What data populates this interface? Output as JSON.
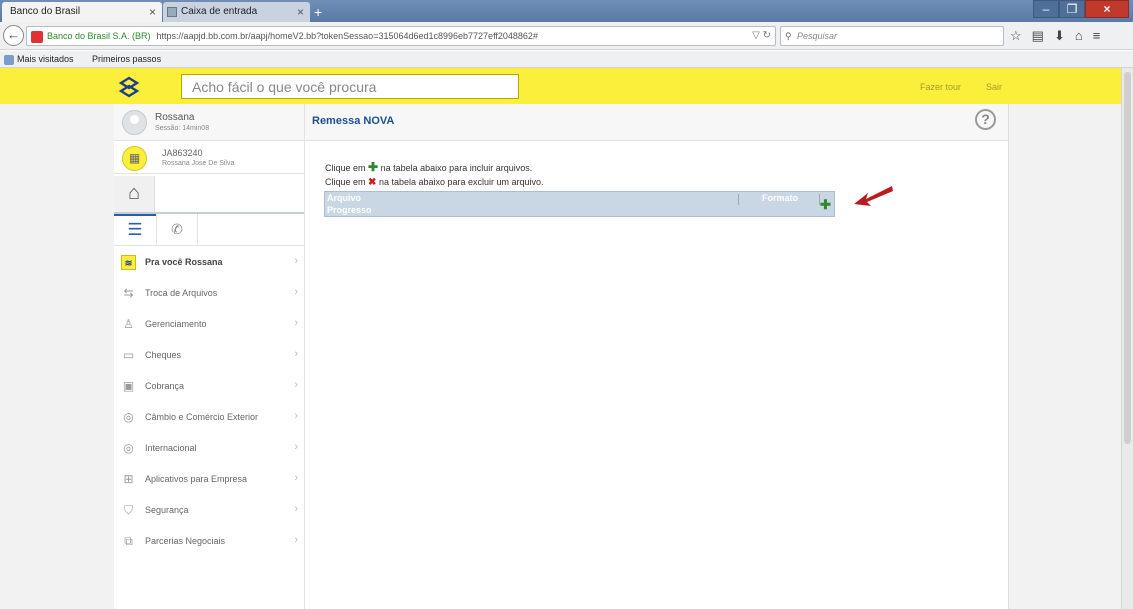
{
  "browser": {
    "tabs": [
      {
        "label": "Banco do Brasil",
        "active": true
      },
      {
        "label": "Caixa de entrada",
        "active": false
      }
    ],
    "new_tab": "+",
    "identity": "Banco do Brasil S.A. (BR)",
    "url": "https://aapjd.bb.com.br/aapj/homeV2.bb?tokenSessao=315064d6ed1c8996eb7727eff2048862#",
    "search_placeholder": "Pesquisar",
    "bookmarks": [
      "Mais visitados",
      "Primeiros passos"
    ]
  },
  "header": {
    "search_placeholder": "Acho fácil o que você procura",
    "links": [
      "Fazer tour",
      "Sair"
    ],
    "brand_color": "#fcef3c"
  },
  "user": {
    "name": "Rossana",
    "session": "Sessão: 14min08"
  },
  "account": {
    "code": "JA863240",
    "holder": "Rossana Jose De Silva"
  },
  "menu": [
    {
      "label": "Pra você Rossana",
      "icon": "bb-logo-icon",
      "strong": true
    },
    {
      "label": "Troca de Arquivos",
      "icon": "file-exchange-icon"
    },
    {
      "label": "Gerenciamento",
      "icon": "people-icon"
    },
    {
      "label": "Cheques",
      "icon": "cheque-icon"
    },
    {
      "label": "Cobrança",
      "icon": "billing-icon"
    },
    {
      "label": "Câmbio e Comércio Exterior",
      "icon": "globe-icon"
    },
    {
      "label": "Internacional",
      "icon": "globe-icon"
    },
    {
      "label": "Aplicativos para Empresa",
      "icon": "apps-icon"
    },
    {
      "label": "Segurança",
      "icon": "shield-icon"
    },
    {
      "label": "Parcerias Negociais",
      "icon": "partners-icon"
    }
  ],
  "main": {
    "title": "Remessa NOVA",
    "instructions": {
      "prefix": "Clique em",
      "add_text": "na tabela abaixo para incluir arquivos.",
      "remove_text": "na tabela abaixo para excluir um arquivo."
    },
    "table": {
      "columns": [
        "Arquivo",
        "Formato",
        "Progresso"
      ]
    }
  }
}
